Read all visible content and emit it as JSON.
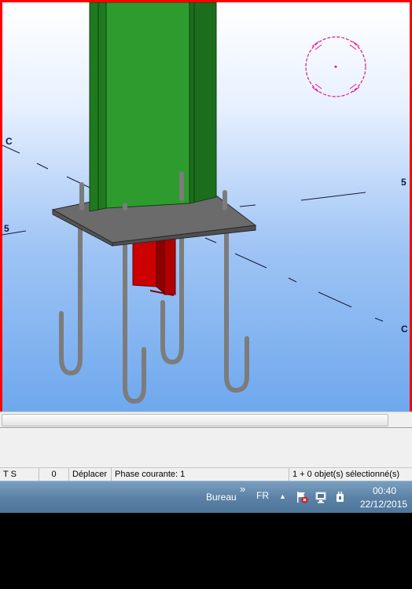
{
  "viewport": {
    "grid_labels": [
      "C",
      "5",
      "5",
      "C"
    ]
  },
  "statusbar": {
    "mode": "T S",
    "count": "0",
    "command": "Déplacer",
    "phase": "Phase courante: 1",
    "selection": "1 + 0 objet(s) sélectionné(s)"
  },
  "taskbar": {
    "toolbar_label": "Bureau",
    "chevron": "»",
    "language": "FR",
    "up_arrow": "▲",
    "time": "00:40",
    "date": "22/12/2015"
  },
  "colors": {
    "frame": "#ff0000",
    "column": "#2e9b2e",
    "plate": "#6b6b6b",
    "bolt": "#7c7c7c",
    "shear_key": "#cc0000",
    "selection_circle": "#e0179b"
  }
}
